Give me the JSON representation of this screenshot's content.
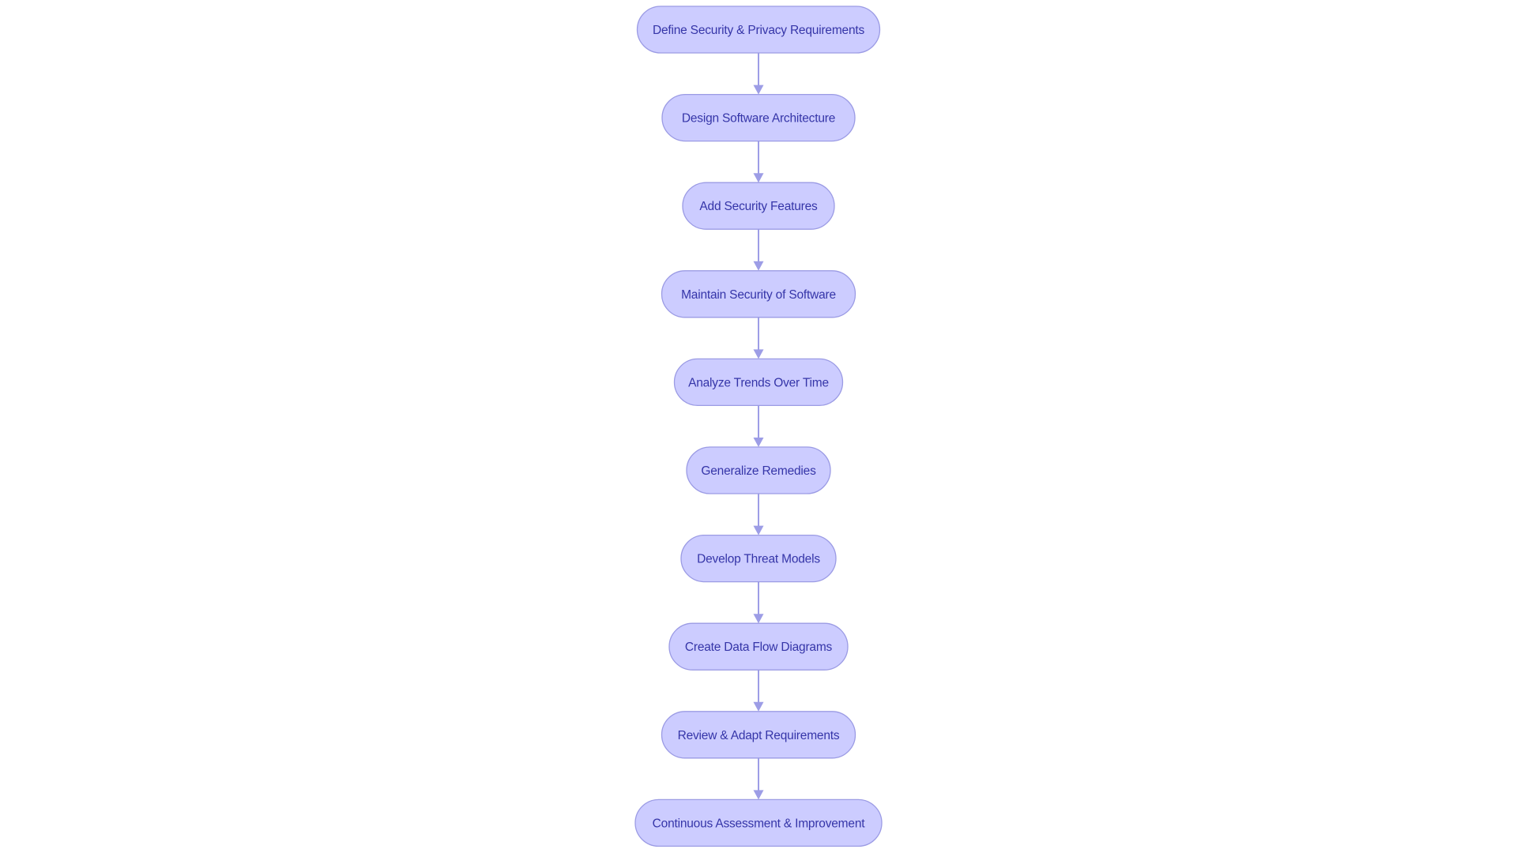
{
  "diagram": {
    "type": "flowchart",
    "direction": "top-to-bottom",
    "colors": {
      "node_fill": "#ccccff",
      "node_border": "#9b9be4",
      "node_text": "#3535a8",
      "edge": "#9d9de6",
      "background": "#ffffff"
    },
    "nodes": [
      {
        "id": "n1",
        "label": "Define Security & Privacy Requirements"
      },
      {
        "id": "n2",
        "label": "Design Software Architecture"
      },
      {
        "id": "n3",
        "label": "Add Security Features"
      },
      {
        "id": "n4",
        "label": "Maintain Security of Software"
      },
      {
        "id": "n5",
        "label": "Analyze Trends Over Time"
      },
      {
        "id": "n6",
        "label": "Generalize Remedies"
      },
      {
        "id": "n7",
        "label": "Develop Threat Models"
      },
      {
        "id": "n8",
        "label": "Create Data Flow Diagrams"
      },
      {
        "id": "n9",
        "label": "Review & Adapt Requirements"
      },
      {
        "id": "n10",
        "label": "Continuous Assessment & Improvement"
      }
    ],
    "edges": [
      {
        "from": "n1",
        "to": "n2"
      },
      {
        "from": "n2",
        "to": "n3"
      },
      {
        "from": "n3",
        "to": "n4"
      },
      {
        "from": "n4",
        "to": "n5"
      },
      {
        "from": "n5",
        "to": "n6"
      },
      {
        "from": "n6",
        "to": "n7"
      },
      {
        "from": "n7",
        "to": "n8"
      },
      {
        "from": "n8",
        "to": "n9"
      },
      {
        "from": "n9",
        "to": "n10"
      }
    ]
  }
}
